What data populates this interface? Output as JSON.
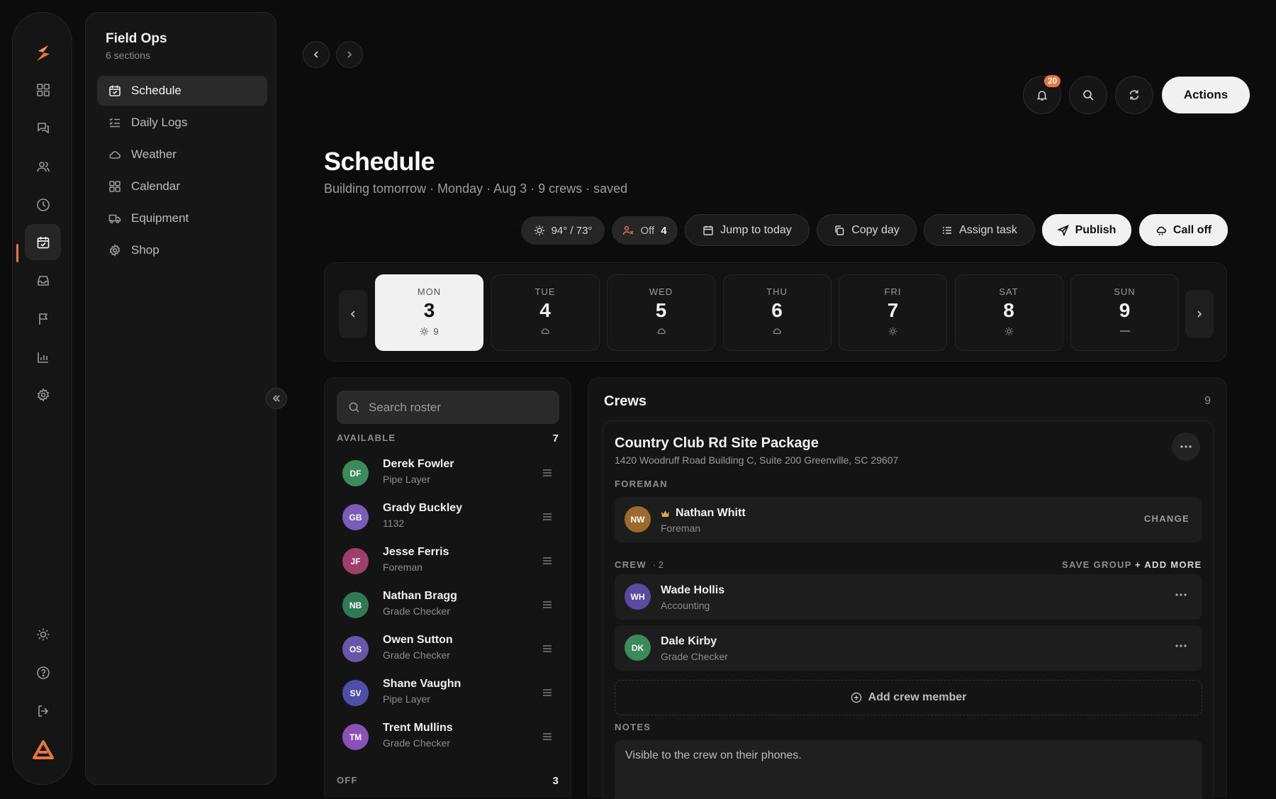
{
  "nav": {
    "sidebar_title": "Field Ops",
    "sidebar_subtitle": "6 sections",
    "items": [
      {
        "label": "Schedule",
        "icon": "calendar-check-icon"
      },
      {
        "label": "Daily Logs",
        "icon": "list-check-icon"
      },
      {
        "label": "Weather",
        "icon": "cloud-icon"
      },
      {
        "label": "Calendar",
        "icon": "grid-icon"
      },
      {
        "label": "Equipment",
        "icon": "truck-icon"
      },
      {
        "label": "Shop",
        "icon": "gear-icon"
      }
    ]
  },
  "topbar": {
    "notification_count": "20",
    "actions_label": "Actions"
  },
  "page": {
    "title": "Schedule",
    "subtitle": "Building tomorrow · Monday · Aug 3 · 9 crews · saved"
  },
  "toolbar": {
    "weather": "94° / 73°",
    "off_label": "Off",
    "off_count": "4",
    "jump_today": "Jump to today",
    "copy_day": "Copy day",
    "assign_task": "Assign task",
    "publish": "Publish",
    "call_off": "Call off"
  },
  "week": [
    {
      "name": "MON",
      "date": "3",
      "weather": "sun",
      "count": "9",
      "selected": true
    },
    {
      "name": "TUE",
      "date": "4",
      "weather": "cloud",
      "count": ""
    },
    {
      "name": "WED",
      "date": "5",
      "weather": "cloud",
      "count": ""
    },
    {
      "name": "THU",
      "date": "6",
      "weather": "cloud",
      "count": ""
    },
    {
      "name": "FRI",
      "date": "7",
      "weather": "sun",
      "count": ""
    },
    {
      "name": "SAT",
      "date": "8",
      "weather": "sun",
      "count": ""
    },
    {
      "name": "SUN",
      "date": "9",
      "weather": "dash",
      "count": ""
    }
  ],
  "roster": {
    "search_placeholder": "Search roster",
    "available_label": "AVAILABLE",
    "available_count": "7",
    "off_label": "OFF",
    "off_count": "3",
    "people": [
      {
        "initials": "DF",
        "name": "Derek Fowler",
        "role": "Pipe Layer",
        "color": "#3c8a5c"
      },
      {
        "initials": "GB",
        "name": "Grady Buckley",
        "role": "1132",
        "color": "#7b5cb8"
      },
      {
        "initials": "JF",
        "name": "Jesse Ferris",
        "role": "Foreman",
        "color": "#9c3f6a"
      },
      {
        "initials": "NB",
        "name": "Nathan Bragg",
        "role": "Grade Checker",
        "color": "#2f7a55"
      },
      {
        "initials": "OS",
        "name": "Owen Sutton",
        "role": "Grade Checker",
        "color": "#6a56a8"
      },
      {
        "initials": "SV",
        "name": "Shane Vaughn",
        "role": "Pipe Layer",
        "color": "#4f4ea6"
      },
      {
        "initials": "TM",
        "name": "Trent Mullins",
        "role": "Grade Checker",
        "color": "#8a52b8"
      }
    ]
  },
  "crews": {
    "title": "Crews",
    "count": "9",
    "job": {
      "name": "Country Club Rd Site Package",
      "address": "1420 Woodruff Road Building C, Suite 200 Greenville, SC 29607",
      "foreman_label": "FOREMAN",
      "foreman": {
        "initials": "NW",
        "name": "Nathan Whitt",
        "role": "Foreman",
        "color": "#9c6a2e"
      },
      "change_label": "CHANGE",
      "crew_label": "CREW",
      "crew_count": "· 2",
      "save_group": "SAVE GROUP",
      "add_more": "+ ADD MORE",
      "members": [
        {
          "initials": "WH",
          "name": "Wade Hollis",
          "role": "Accounting",
          "color": "#5a4aa0"
        },
        {
          "initials": "DK",
          "name": "Dale Kirby",
          "role": "Grade Checker",
          "color": "#3c8a5c"
        }
      ],
      "add_member": "Add crew member",
      "notes_label": "NOTES",
      "notes_placeholder": "Visible to the crew on their phones."
    }
  },
  "colors": {
    "accent": "#e8763c",
    "background": "#0c0c0c"
  }
}
